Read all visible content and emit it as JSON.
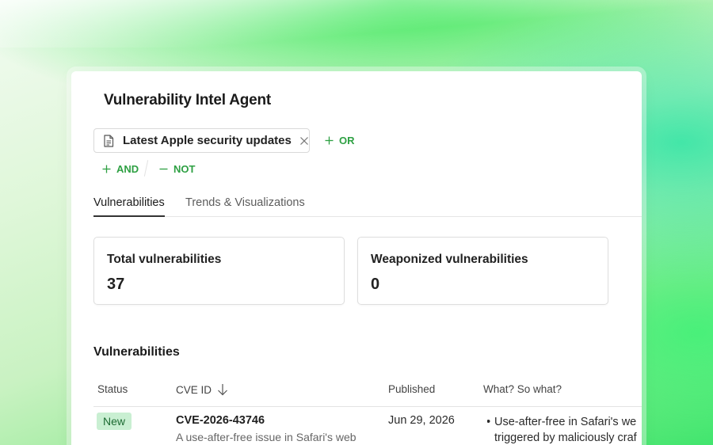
{
  "agent": {
    "title": "Vulnerability Intel Agent"
  },
  "filters": {
    "chip_label": "Latest Apple security updates",
    "or_label": "OR",
    "and_label": "AND",
    "not_label": "NOT"
  },
  "tabs": [
    {
      "label": "Vulnerabilities",
      "active": true
    },
    {
      "label": "Trends & Visualizations",
      "active": false
    }
  ],
  "stats": {
    "total": {
      "label": "Total vulnerabilities",
      "value": "37"
    },
    "weaponized": {
      "label": "Weaponized vulnerabilities",
      "value": "0"
    }
  },
  "table": {
    "title": "Vulnerabilities",
    "headers": {
      "status": "Status",
      "cve": "CVE ID",
      "published": "Published",
      "what": "What? So what?"
    },
    "rows": [
      {
        "status": "New",
        "cve_id": "CVE-2026-43746",
        "description": "A use-after-free issue in Safari's web",
        "published": "Jun 29, 2026",
        "what_line1": "Use-after-free in Safari's we",
        "what_line2": "triggered by maliciously craf"
      }
    ]
  },
  "colors": {
    "accent_green": "#2ea043",
    "badge_bg": "#c9efd2",
    "badge_text": "#1d6b33"
  },
  "icons": {
    "chip": "document-icon",
    "chip_remove": "close-icon",
    "add": "plus-icon",
    "exclude": "minus-icon",
    "sort": "arrow-down-icon"
  }
}
